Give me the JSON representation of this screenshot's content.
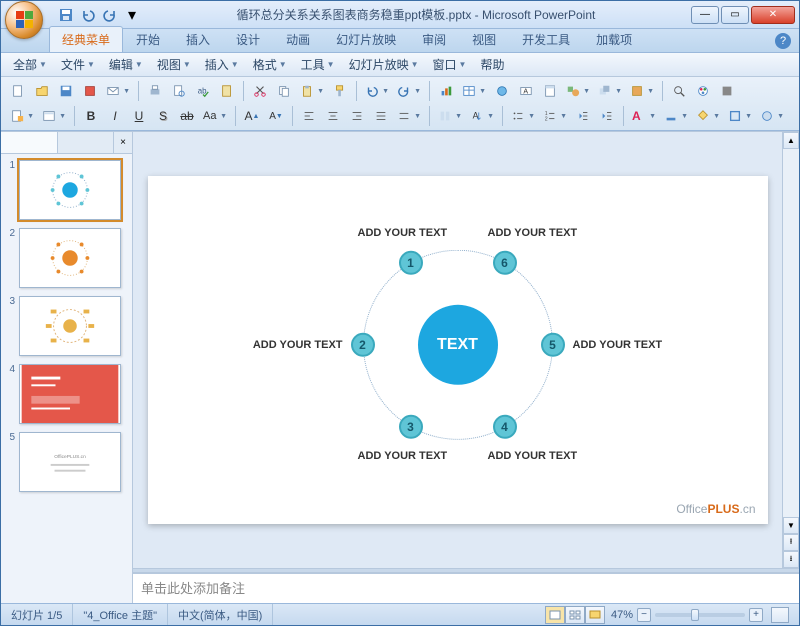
{
  "window": {
    "title": "循环总分关系关系图表商务稳重ppt模板.pptx - Microsoft PowerPoint"
  },
  "qat": {
    "save": "💾",
    "undo": "↶",
    "redo": "↷",
    "more": "▾"
  },
  "win_controls": {
    "min": "—",
    "max": "▭",
    "close": "✕"
  },
  "ribbon_tabs": [
    "经典菜单",
    "开始",
    "插入",
    "设计",
    "动画",
    "幻灯片放映",
    "审阅",
    "视图",
    "开发工具",
    "加载项"
  ],
  "ribbon_active": 0,
  "help": "?",
  "menubar": [
    "全部",
    "文件",
    "编辑",
    "视图",
    "插入",
    "格式",
    "工具",
    "幻灯片放映",
    "窗口",
    "帮助"
  ],
  "slide_panel": {
    "tab_slides": " ",
    "tab_outline": " ",
    "close": "×"
  },
  "slides": [
    {
      "num": "1",
      "selected": true,
      "kind": "cycle-blue"
    },
    {
      "num": "2",
      "selected": false,
      "kind": "cycle-orange"
    },
    {
      "num": "3",
      "selected": false,
      "kind": "cycle-orange2"
    },
    {
      "num": "4",
      "selected": false,
      "kind": "red-card"
    },
    {
      "num": "5",
      "selected": false,
      "kind": "blank-footer"
    }
  ],
  "diagram": {
    "center": "TEXT",
    "labels": [
      "ADD YOUR TEXT",
      "ADD YOUR TEXT",
      "ADD YOUR TEXT",
      "ADD YOUR TEXT",
      "ADD YOUR TEXT",
      "ADD YOUR TEXT"
    ],
    "nums": [
      "1",
      "2",
      "3",
      "4",
      "5",
      "6"
    ]
  },
  "watermark": {
    "a": "Office",
    "b": "PLUS",
    "c": ".cn"
  },
  "notes": {
    "placeholder": "单击此处添加备注"
  },
  "status": {
    "slide": "幻灯片 1/5",
    "theme": "\"4_Office 主题\"",
    "lang": "中文(简体，中国)",
    "zoom": "47%"
  },
  "chart_data": {
    "type": "diagram",
    "title": "TEXT",
    "nodes": [
      {
        "id": 1,
        "label": "ADD YOUR TEXT"
      },
      {
        "id": 2,
        "label": "ADD YOUR TEXT"
      },
      {
        "id": 3,
        "label": "ADD YOUR TEXT"
      },
      {
        "id": 4,
        "label": "ADD YOUR TEXT"
      },
      {
        "id": 5,
        "label": "ADD YOUR TEXT"
      },
      {
        "id": 6,
        "label": "ADD YOUR TEXT"
      }
    ],
    "layout": "radial-cycle"
  }
}
